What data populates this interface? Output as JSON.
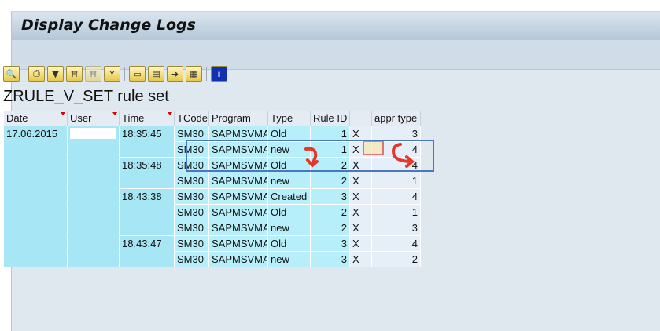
{
  "window": {
    "title": "Display Change Logs"
  },
  "toolbar": {
    "icons": [
      "details-icon",
      "print-preview-icon",
      "filter-icon",
      "find-icon",
      "find-next-icon",
      "set-filter-icon",
      "print-icon",
      "export-icon",
      "save-layout-icon",
      "layout-grid-icon",
      "info-icon"
    ]
  },
  "report": {
    "title": "ZRULE_V_SET rule set"
  },
  "table": {
    "columns": [
      "Date",
      "User",
      "Time",
      "TCode",
      "Program",
      "Type",
      "Rule ID",
      "",
      "appr type"
    ],
    "rows": [
      [
        "17.06.2015",
        "",
        "18:35:45",
        "SM30",
        "SAPMSVMA",
        "Old",
        "1",
        "X",
        "3"
      ],
      [
        "",
        "",
        "",
        "SM30",
        "SAPMSVMA",
        "new",
        "1",
        "X",
        "4"
      ],
      [
        "",
        "",
        "18:35:48",
        "SM30",
        "SAPMSVMA",
        "Old",
        "2",
        "X",
        "4"
      ],
      [
        "",
        "",
        "",
        "SM30",
        "SAPMSVMA",
        "new",
        "2",
        "X",
        "1"
      ],
      [
        "",
        "",
        "18:43:38",
        "SM30",
        "SAPMSVMA",
        "Created",
        "3",
        "X",
        "4"
      ],
      [
        "",
        "",
        "",
        "SM30",
        "SAPMSVMA",
        "Old",
        "2",
        "X",
        "1"
      ],
      [
        "",
        "",
        "",
        "SM30",
        "SAPMSVMA",
        "new",
        "2",
        "X",
        "3"
      ],
      [
        "",
        "",
        "18:43:47",
        "SM30",
        "SAPMSVMA",
        "Old",
        "3",
        "X",
        "4"
      ],
      [
        "",
        "",
        "",
        "SM30",
        "SAPMSVMA",
        "new",
        "3",
        "X",
        "2"
      ]
    ]
  },
  "colors": {
    "key": "#a7e6f4",
    "data": "#b6eefa",
    "highlight": "#4a78c0",
    "annotation": "#e8352a"
  }
}
